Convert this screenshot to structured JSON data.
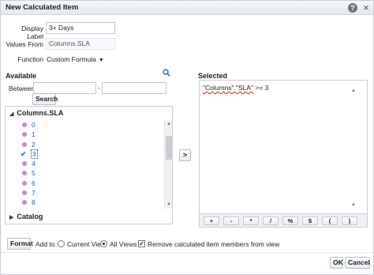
{
  "dialog": {
    "title": "New Calculated Item",
    "help_label": "?",
    "close_label": "×"
  },
  "form": {
    "display_label": "Display Label",
    "display_value": "3+ Days",
    "values_from_label": "Values From",
    "values_from_value": "Columns.SLA",
    "function_label": "Function",
    "function_value": "Custom Formula",
    "function_arrow": "▼"
  },
  "available": {
    "heading": "Available",
    "between_label": "Between",
    "between_dash": "-",
    "search_button": "Search",
    "root_label": "Columns.SLA",
    "root_toggle": "◢",
    "items": [
      {
        "label": "0"
      },
      {
        "label": "1"
      },
      {
        "label": "2"
      },
      {
        "label": "3",
        "checked": true
      },
      {
        "label": "4"
      },
      {
        "label": "5"
      },
      {
        "label": "6"
      },
      {
        "label": "7"
      },
      {
        "label": "8"
      }
    ],
    "check_glyph": "✔",
    "catalog_label": "Catalog",
    "catalog_toggle": "▶",
    "scroll_up": "▲",
    "scroll_down": "▼"
  },
  "move_button": ">",
  "selected": {
    "heading": "Selected",
    "formula_prefix": "\"Columns\".\"SLA\"",
    "formula_suffix": " >= 3",
    "scroll_up": "▲",
    "scroll_down": "▼"
  },
  "operators": [
    "+",
    "-",
    "*",
    "/",
    "%",
    "$",
    "(",
    ")"
  ],
  "bottom": {
    "format_button": "Format",
    "add_to_label": "Add to",
    "current_view_label": "Current View",
    "current_view_selected": false,
    "all_views_label": "All Views",
    "all_views_selected": true,
    "remove_label": "Remove calculated item members from view",
    "remove_checked": true,
    "checkbox_glyph": "✓"
  },
  "actions": {
    "ok": "OK",
    "cancel": "Cancel"
  }
}
